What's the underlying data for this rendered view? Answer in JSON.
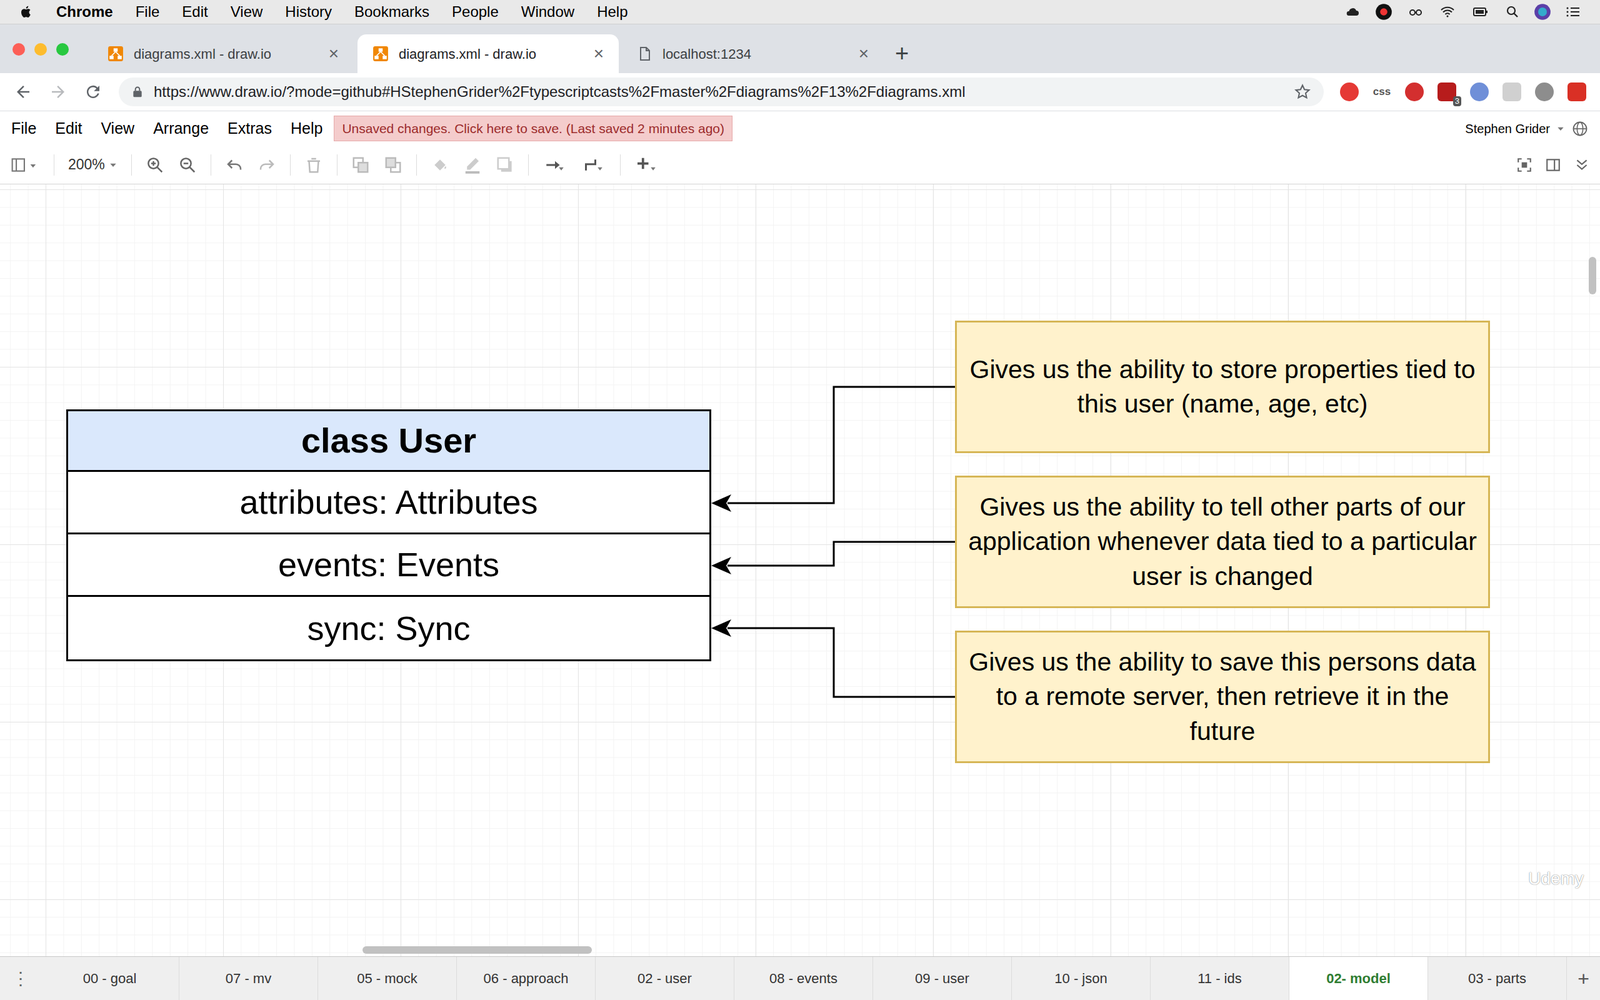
{
  "menubar": {
    "app": "Chrome",
    "items": [
      "File",
      "Edit",
      "View",
      "History",
      "Bookmarks",
      "People",
      "Window",
      "Help"
    ]
  },
  "browser": {
    "tabs": [
      {
        "label": "diagrams.xml - draw.io",
        "kind": "drawio",
        "selected": false,
        "close": "×"
      },
      {
        "label": "diagrams.xml - draw.io",
        "kind": "drawio",
        "selected": true,
        "close": "×"
      },
      {
        "label": "localhost:1234",
        "kind": "page",
        "selected": false,
        "close": "×"
      }
    ],
    "new_tab": "+",
    "url": "https://www.draw.io/?mode=github#HStephenGrider%2Ftypescriptcasts%2Fmaster%2Fdiagrams%2F13%2Fdiagrams.xml",
    "extensions": [
      {
        "color": "#e53935"
      },
      {
        "color": "#ffffff",
        "text": "css"
      },
      {
        "color": "#d32f2f"
      },
      {
        "color": "#b71c1c",
        "badge": "3"
      },
      {
        "color": "#6f8fd8"
      },
      {
        "color": "#d0d0d0"
      },
      {
        "color": "#8d8d8d"
      },
      {
        "color": "#d93025"
      }
    ]
  },
  "drawio": {
    "menu": [
      "File",
      "Edit",
      "View",
      "Arrange",
      "Extras",
      "Help"
    ],
    "notice": "Unsaved changes. Click here to save. (Last saved 2 minutes ago)",
    "user": "Stephen Grider",
    "zoom": "200%"
  },
  "diagram": {
    "class": {
      "title": "class User",
      "fields": [
        "attributes: Attributes",
        "events: Events",
        "sync: Sync"
      ]
    },
    "notes": [
      "Gives us the ability to store properties tied to this user (name, age, etc)",
      "Gives us the ability to tell other parts of our application whenever data tied to a particular user is changed",
      "Gives us the ability to save this persons data to a remote server, then retrieve it in the future"
    ]
  },
  "watermark": "Udemy",
  "pages": {
    "menu": "⋮",
    "add": "+",
    "tabs": [
      {
        "label": "00 - goal",
        "selected": false
      },
      {
        "label": "07 - mv",
        "selected": false
      },
      {
        "label": "05 - mock",
        "selected": false
      },
      {
        "label": "06 - approach",
        "selected": false
      },
      {
        "label": "02 - user",
        "selected": false
      },
      {
        "label": "08 - events",
        "selected": false
      },
      {
        "label": "09 - user",
        "selected": false
      },
      {
        "label": "10 - json",
        "selected": false
      },
      {
        "label": "11 - ids",
        "selected": false
      },
      {
        "label": "02- model",
        "selected": true
      },
      {
        "label": "03 - parts",
        "selected": false
      }
    ]
  }
}
